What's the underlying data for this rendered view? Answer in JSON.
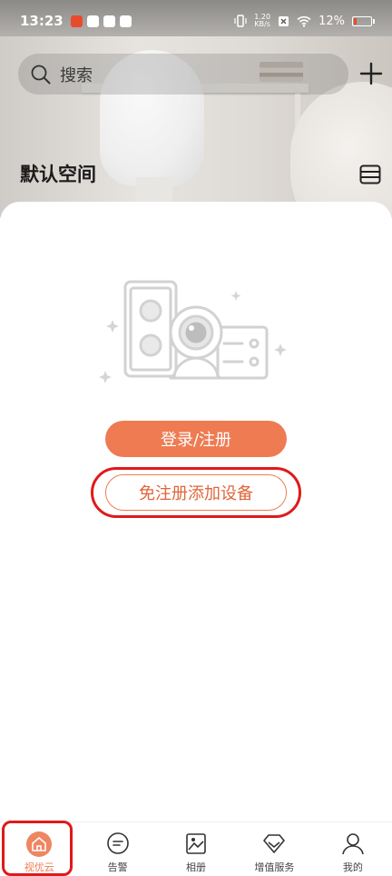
{
  "status_bar": {
    "time": "13:23",
    "net_speed_value": "1.20",
    "net_speed_unit": "KB/s",
    "battery": "12%"
  },
  "search": {
    "placeholder": "搜索"
  },
  "space": {
    "title": "默认空间"
  },
  "actions": {
    "login_label": "登录/注册",
    "add_device_label": "免注册添加设备"
  },
  "bottom_nav": {
    "items": [
      {
        "label": "视优云",
        "icon": "home-icon",
        "active": true
      },
      {
        "label": "告警",
        "icon": "message-icon",
        "active": false
      },
      {
        "label": "相册",
        "icon": "album-icon",
        "active": false
      },
      {
        "label": "增值服务",
        "icon": "diamond-icon",
        "active": false
      },
      {
        "label": "我的",
        "icon": "person-icon",
        "active": false
      }
    ]
  },
  "colors": {
    "accent": "#ee7b52",
    "annotation": "#e01a1a"
  }
}
